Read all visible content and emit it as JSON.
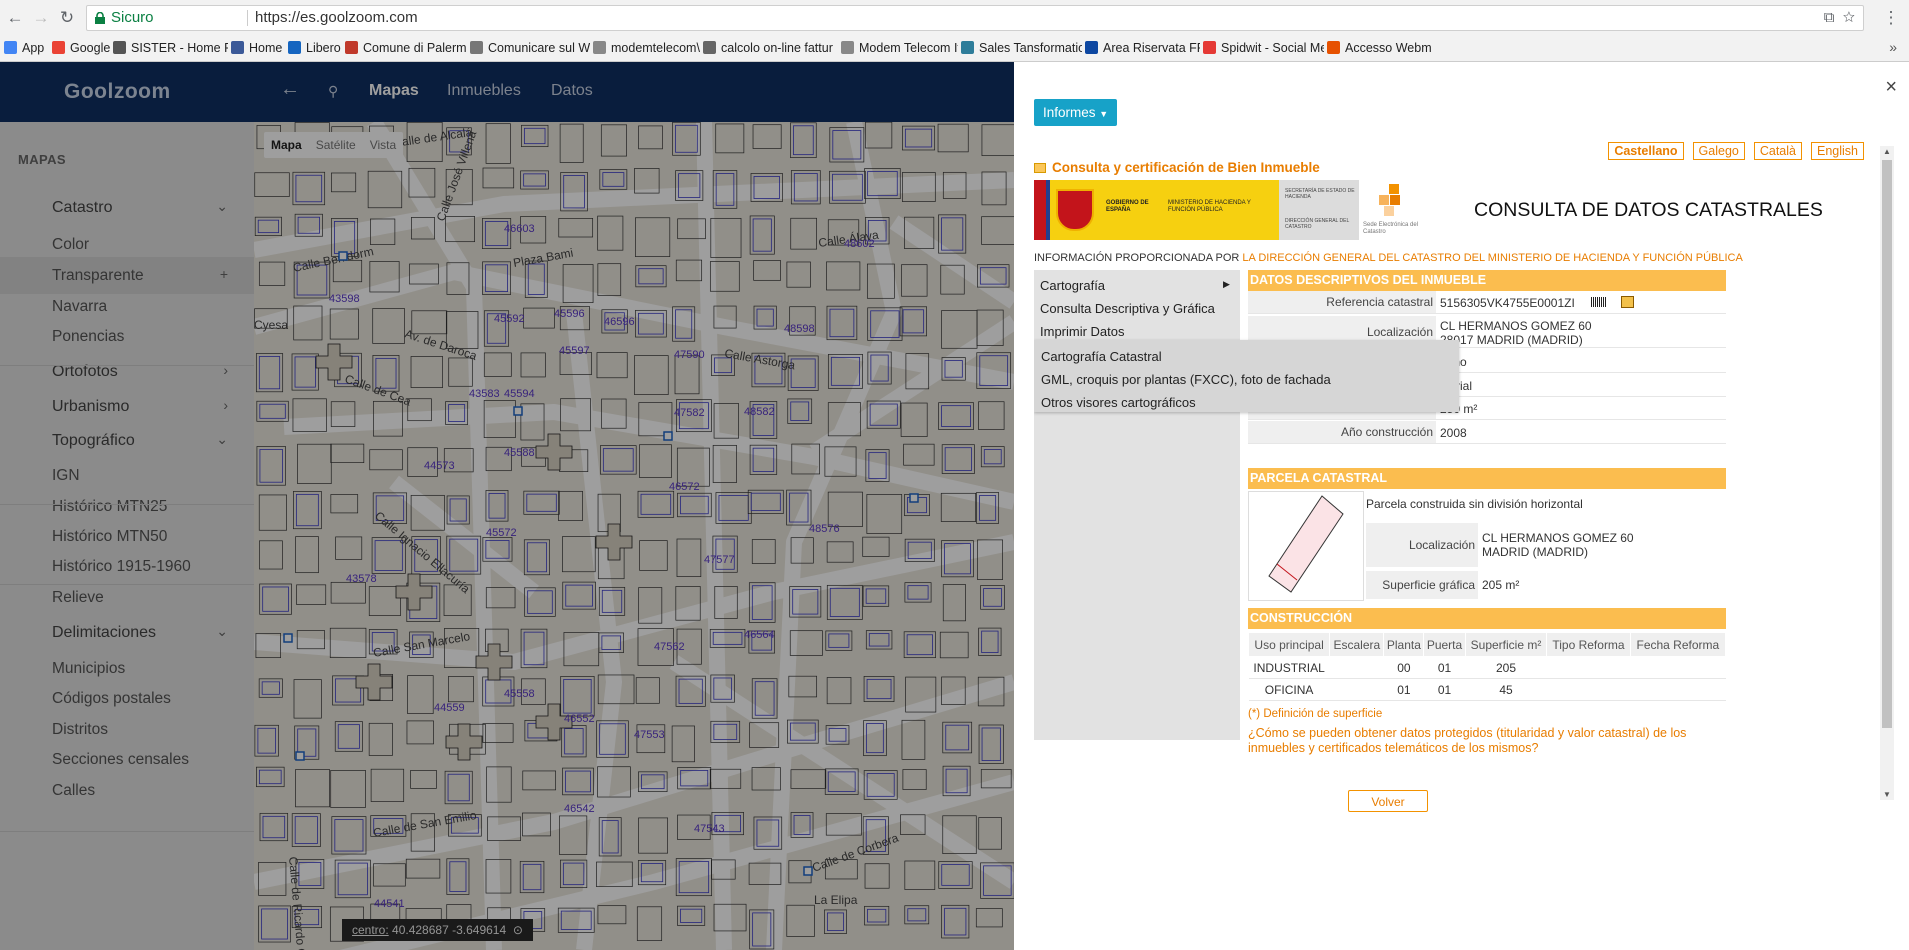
{
  "browser": {
    "secure_label": "Sicuro",
    "url": "https://es.goolzoom.com",
    "bookmarks": [
      {
        "label": "App",
        "color": "#4285f4"
      },
      {
        "label": "Google",
        "color": "#ea4335"
      },
      {
        "label": "SISTER - Home Page",
        "color": "#555555"
      },
      {
        "label": "Home",
        "color": "#3b5998"
      },
      {
        "label": "Libero",
        "color": "#1565c0"
      },
      {
        "label": "Comune di Palermo -",
        "color": "#c0392b"
      },
      {
        "label": "Comunicare sul Web",
        "color": "#777777"
      },
      {
        "label": "modemtelecom\\Disk",
        "color": "#888888"
      },
      {
        "label": "calcolo on-line fattur",
        "color": "#666666"
      },
      {
        "label": "Modem Telecom Itali",
        "color": "#888888"
      },
      {
        "label": "Sales Tansformation -",
        "color": "#2e7d9a"
      },
      {
        "label": "Area Riservata FPMF",
        "color": "#0d47a1"
      },
      {
        "label": "Spidwit - Social Medi",
        "color": "#e53935"
      },
      {
        "label": "Accesso Webmail",
        "color": "#e65100"
      }
    ]
  },
  "app": {
    "logo": "Goolzoom",
    "nav": {
      "mapas": "Mapas",
      "inmuebles": "Inmuebles",
      "datos": "Datos"
    },
    "sidebar": {
      "heading": "MAPAS",
      "items": [
        {
          "label": "Catastro",
          "chevron": "⌄"
        },
        {
          "label": "Color",
          "chevron": ""
        },
        {
          "label": "Transparente",
          "chevron": "+"
        },
        {
          "label": "Navarra",
          "chevron": ""
        },
        {
          "label": "Ponencias",
          "chevron": ""
        },
        {
          "label": "Ortofotos",
          "chevron": "›"
        },
        {
          "label": "Urbanismo",
          "chevron": "›"
        },
        {
          "label": "Topográfico",
          "chevron": "⌄"
        },
        {
          "label": "IGN",
          "chevron": ""
        },
        {
          "label": "Histórico MTN25",
          "chevron": ""
        },
        {
          "label": "Histórico MTN50",
          "chevron": ""
        },
        {
          "label": "Histórico 1915-1960",
          "chevron": ""
        },
        {
          "label": "Relieve",
          "chevron": ""
        },
        {
          "label": "Delimitaciones",
          "chevron": "⌄"
        },
        {
          "label": "Municipios",
          "chevron": ""
        },
        {
          "label": "Códigos postales",
          "chevron": ""
        },
        {
          "label": "Distritos",
          "chevron": ""
        },
        {
          "label": "Secciones censales",
          "chevron": ""
        },
        {
          "label": "Calles",
          "chevron": ""
        }
      ]
    },
    "map": {
      "tabs": {
        "mapa": "Mapa",
        "satelite": "Satélite",
        "vista": "Vista"
      },
      "coord_label": "centro:",
      "coord_value": "40.428687 -3.649614",
      "streets": [
        "Calle de Alcalá",
        "Calle Benidorm",
        "Calle Álava",
        "Av. de Daroca",
        "Calle Astorga",
        "Calle de Cea",
        "Calle San Marcelo",
        "Calle de San Emilio",
        "Calle de Ricardo Ortiz",
        "Calle Ignacio Ellacuría",
        "Calle José Villena",
        "Calle de Corbera",
        "Plaza Bami",
        "Cyesa",
        "La Elipa"
      ],
      "parcel_numbers": [
        "43598",
        "45592",
        "45596",
        "46596",
        "45597",
        "47590",
        "48598",
        "43583",
        "45594",
        "47582",
        "48582",
        "44573",
        "45588",
        "46572",
        "45572",
        "47577",
        "48576",
        "43578",
        "47562",
        "46564",
        "44559",
        "45558",
        "46552",
        "47553",
        "46542",
        "47543",
        "44541",
        "46603",
        "48602"
      ]
    }
  },
  "modal": {
    "informes": "Informes",
    "close": "×",
    "languages": [
      "Castellano",
      "Galego",
      "Català",
      "English"
    ],
    "header_title": "Consulta y certificación de Bien Inmueble",
    "banner": {
      "gobierno": "GOBIERNO DE ESPAÑA",
      "ministerio": "MINISTERIO DE HACIENDA Y FUNCIÓN PÚBLICA",
      "secretaria": "SECRETARÍA DE ESTADO DE HACIENDA",
      "direccion": "DIRECCIÓN GENERAL DEL CATASTRO",
      "sede": "Sede Electrónica del Catastro"
    },
    "page_title": "CONSULTA DE DATOS CATASTRALES",
    "info_prefix": "INFORMACIÓN PROPORCIONADA POR ",
    "info_org": "LA DIRECCIÓN GENERAL DEL CATASTRO DEL MINISTERIO DE HACIENDA Y FUNCIÓN PÚBLICA",
    "left_menu": [
      "Cartografía",
      "Consulta Descriptiva y Gráfica",
      "Imprimir Datos"
    ],
    "submenu": [
      "Cartografía Catastral",
      "GML, croquis por plantas (FXCC), foto de fachada",
      "Otros visores cartográficos"
    ],
    "datos": {
      "title": "DATOS DESCRIPTIVOS DEL INMUEBLE",
      "rows": [
        {
          "label": "Referencia catastral",
          "value": "5156305VK4755E0001ZI"
        },
        {
          "label": "Localización",
          "value": "CL HERMANOS GOMEZ 60",
          "value2": "28017 MADRID (MADRID)"
        },
        {
          "label": "",
          "value": "bano"
        },
        {
          "label": "",
          "value": "ustrial"
        },
        {
          "label": "",
          "value": "250 m²"
        },
        {
          "label": "Año construcción",
          "value": "2008"
        }
      ]
    },
    "parcela": {
      "title": "PARCELA CATASTRAL",
      "desc": "Parcela construida sin división horizontal",
      "loc_label": "Localización",
      "loc1": "CL HERMANOS GOMEZ 60",
      "loc2": "MADRID (MADRID)",
      "sup_label": "Superficie gráfica",
      "sup_value": "205 m²"
    },
    "construccion": {
      "title": "CONSTRUCCIÓN",
      "headers": [
        "Uso principal",
        "Escalera",
        "Planta",
        "Puerta",
        "Superficie m²",
        "Tipo Reforma",
        "Fecha Reforma"
      ],
      "rows": [
        [
          "INDUSTRIAL",
          "",
          "00",
          "01",
          "205",
          "",
          ""
        ],
        [
          "OFICINA",
          "",
          "01",
          "01",
          "45",
          "",
          ""
        ]
      ]
    },
    "definicion": "(*) Definición de superficie",
    "how": "¿Cómo se pueden obtener datos protegidos (titularidad y valor catastral) de los inmuebles y certificados telemáticos de los mismos?",
    "volver": "Volver"
  }
}
